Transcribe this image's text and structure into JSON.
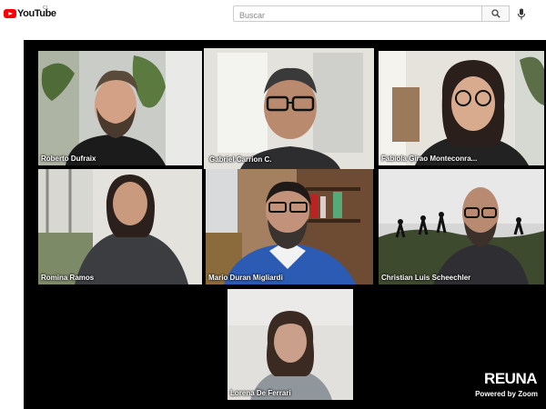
{
  "header": {
    "logo_text": "YouTube",
    "country_code": "CL",
    "search_placeholder": "Buscar",
    "icons": [
      "youtube-logo-icon",
      "search-icon",
      "microphone-icon"
    ]
  },
  "meeting": {
    "participants": [
      {
        "name": "Roberto Dufraix",
        "active": false
      },
      {
        "name": "Gabriel Carrion C.",
        "active": true
      },
      {
        "name": "Fabiola Girao Monteconra...",
        "active": false
      },
      {
        "name": "Romina Ramos",
        "active": false
      },
      {
        "name": "Mario Duran Migliardi",
        "active": false
      },
      {
        "name": "Christian Luis Scheechler",
        "active": false
      },
      {
        "name": "Lorena De Ferrari",
        "active": false
      }
    ],
    "brand": "REUNA",
    "powered_by": "Powered by Zoom",
    "active_speaker_color": "#ffef00"
  }
}
